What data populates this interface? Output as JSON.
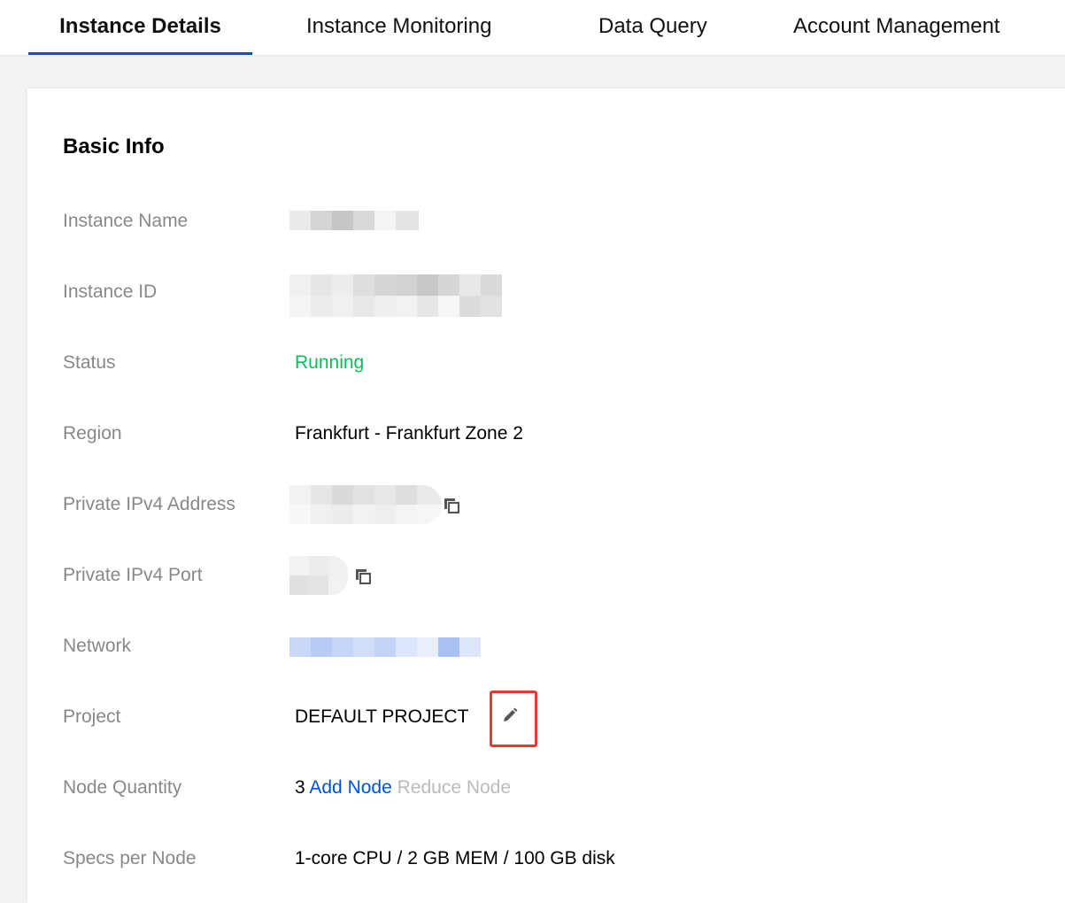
{
  "tabs": [
    {
      "label": "Instance Details",
      "active": true
    },
    {
      "label": "Instance Monitoring",
      "active": false
    },
    {
      "label": "Data Query",
      "active": false
    },
    {
      "label": "Account Management",
      "active": false
    }
  ],
  "basic_info": {
    "title": "Basic Info",
    "rows": {
      "instance_name": {
        "label": "Instance Name"
      },
      "instance_id": {
        "label": "Instance ID"
      },
      "status": {
        "label": "Status",
        "value": "Running"
      },
      "region": {
        "label": "Region",
        "value": "Frankfurt - Frankfurt Zone 2"
      },
      "private_ipv4_address": {
        "label": "Private IPv4 Address"
      },
      "private_ipv4_port": {
        "label": "Private IPv4 Port"
      },
      "network": {
        "label": "Network"
      },
      "project": {
        "label": "Project",
        "value": "DEFAULT PROJECT"
      },
      "node_quantity": {
        "label": "Node Quantity",
        "value": "3",
        "add_label": "Add Node",
        "reduce_label": "Reduce Node"
      },
      "specs_per_node": {
        "label": "Specs per Node",
        "value": "1-core CPU / 2 GB MEM / 100 GB disk"
      }
    }
  },
  "icons": {
    "copy": "copy-icon",
    "edit": "pencil-icon"
  },
  "colors": {
    "accent": "#0052d9",
    "running": "#0abf5b",
    "highlight": "#e53935"
  }
}
